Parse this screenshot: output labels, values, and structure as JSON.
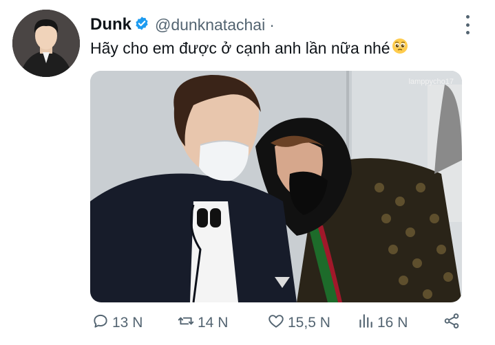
{
  "tweet": {
    "author_name": "Dunk",
    "handle": "@dunknatachai",
    "separator": "·",
    "text": "Hãy cho em được ở cạnh anh lần nữa nhé",
    "emoji_icon": "pleading-face-emoji",
    "media_watermark": "lamppycho17"
  },
  "actions": {
    "replies": "13 N",
    "retweets": "14 N",
    "likes": "15,5 N",
    "views": "16 N"
  },
  "colors": {
    "verified": "#1d9bf0",
    "secondary_text": "#536471",
    "primary_text": "#0f1419"
  }
}
